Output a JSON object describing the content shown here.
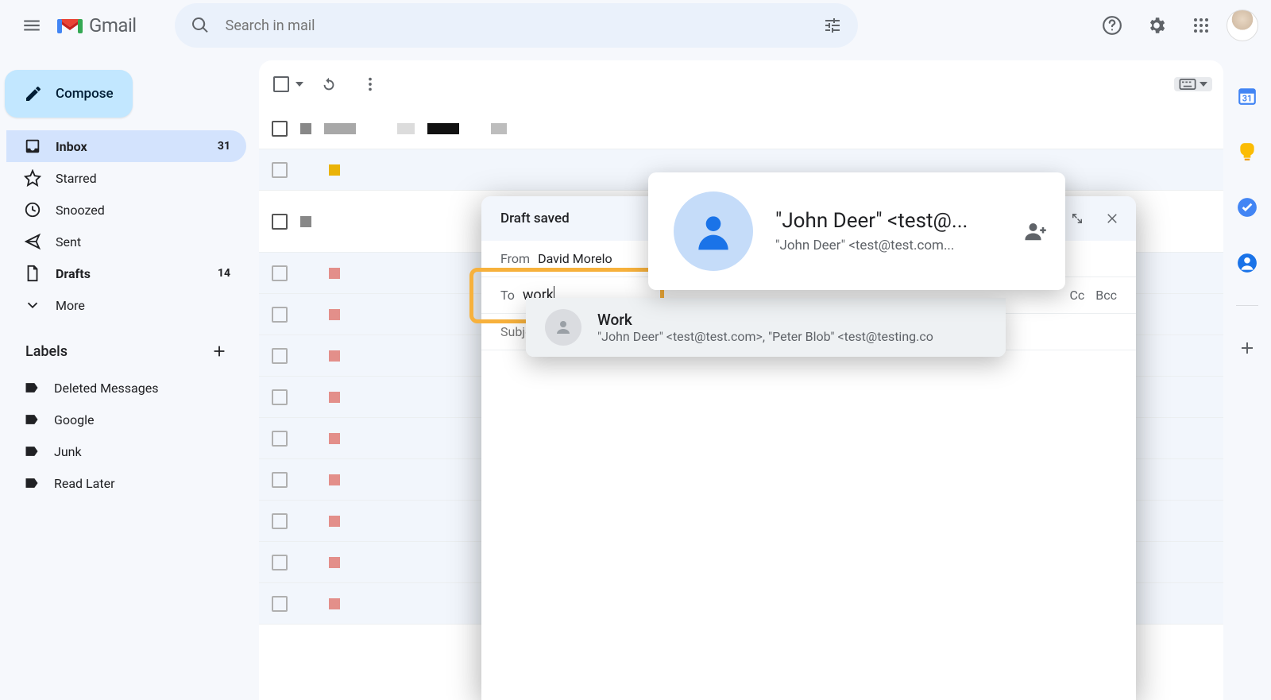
{
  "header": {
    "product": "Gmail",
    "search_placeholder": "Search in mail"
  },
  "sidebar": {
    "compose": "Compose",
    "nav": [
      {
        "label": "Inbox",
        "count": "31",
        "active": true,
        "bold": true
      },
      {
        "label": "Starred",
        "count": "",
        "active": false,
        "bold": false
      },
      {
        "label": "Snoozed",
        "count": "",
        "active": false,
        "bold": false
      },
      {
        "label": "Sent",
        "count": "",
        "active": false,
        "bold": false
      },
      {
        "label": "Drafts",
        "count": "14",
        "active": false,
        "bold": true
      },
      {
        "label": "More",
        "count": "",
        "active": false,
        "bold": false
      }
    ],
    "labels_header": "Labels",
    "labels": [
      {
        "label": "Deleted Messages"
      },
      {
        "label": "Google"
      },
      {
        "label": "Junk"
      },
      {
        "label": "Read Later"
      }
    ]
  },
  "compose": {
    "header_title": "Draft saved",
    "from_label": "From",
    "from_value": "David Morelo",
    "to_label": "To",
    "to_value": "work",
    "subject_label": "Subject",
    "subject_placeholder": "Subject",
    "cc_label": "Cc",
    "bcc_label": "Bcc"
  },
  "contact_card": {
    "name": "\"John Deer\" <test@...",
    "email": "\"John Deer\" <test@test.com..."
  },
  "suggestion": {
    "title": "Work",
    "subtitle": "\"John Deer\" <test@test.com>, \"Peter Blob\" <test@testing.co"
  }
}
